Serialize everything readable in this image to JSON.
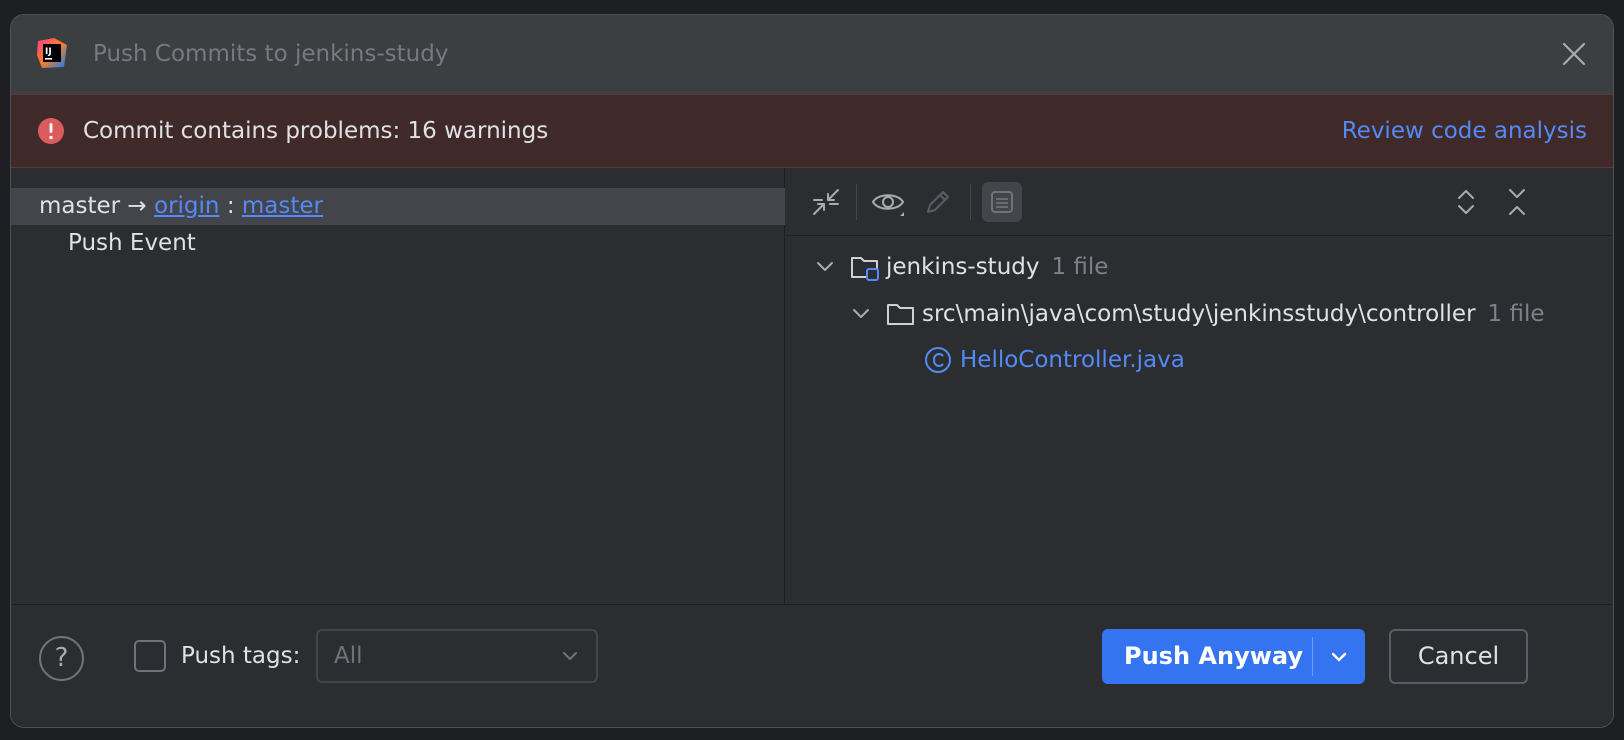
{
  "window": {
    "title": "Push Commits to jenkins-study"
  },
  "banner": {
    "message": "Commit contains problems: 16 warnings",
    "link": "Review code analysis"
  },
  "left_panel": {
    "local_branch": "master",
    "arrow": "→",
    "remote": "origin",
    "separator": ":",
    "remote_branch": "master",
    "commits": [
      {
        "message": "Push Event"
      }
    ]
  },
  "right_panel": {
    "toolbar": {
      "icons": [
        "collapse-arrows-icon",
        "eye-icon",
        "pencil-icon",
        "commit-details-icon",
        "expand-all-icon",
        "collapse-all-icon"
      ]
    },
    "tree": {
      "repo": {
        "name": "jenkins-study",
        "count": "1 file"
      },
      "folder": {
        "path": "src\\main\\java\\com\\study\\jenkinsstudy\\controller",
        "count": "1 file"
      },
      "file": {
        "name": "HelloController.java"
      }
    }
  },
  "footer": {
    "help": "?",
    "push_tags_label": "Push tags:",
    "push_tags_checked": false,
    "push_tags_value": "All",
    "push_button": "Push Anyway",
    "cancel_button": "Cancel"
  },
  "colors": {
    "accent": "#3574f0",
    "link": "#548af7",
    "error": "#db5c5c",
    "banner_bg": "#402929"
  }
}
